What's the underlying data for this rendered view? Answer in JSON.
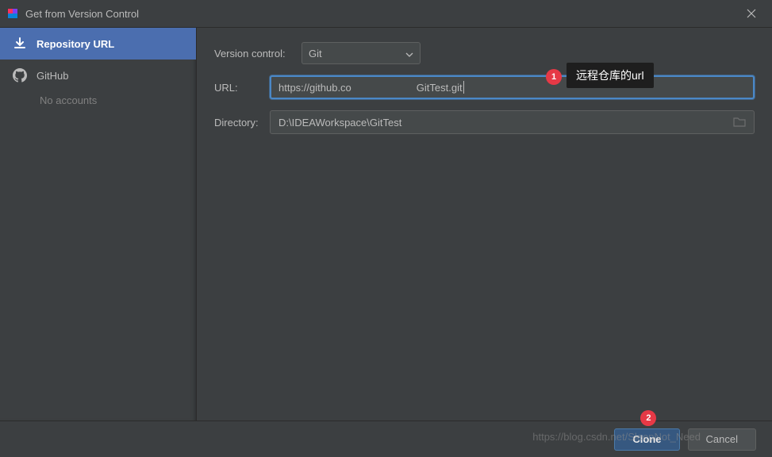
{
  "titlebar": {
    "title": "Get from Version Control"
  },
  "sidebar": {
    "items": [
      {
        "label": "Repository URL"
      },
      {
        "label": "GitHub",
        "sublabel": "No accounts"
      }
    ]
  },
  "form": {
    "version_control_label": "Version control:",
    "version_control_value": "Git",
    "url_label": "URL:",
    "url_value_prefix": "https://github.co",
    "url_value_suffix": "GitTest.git",
    "directory_label": "Directory:",
    "directory_value": "D:\\IDEAWorkspace\\GitTest"
  },
  "annotations": {
    "badge1": "1",
    "label1": "远程仓库的url",
    "badge2": "2"
  },
  "footer": {
    "clone": "Clone",
    "cancel": "Cancel"
  },
  "watermark": "https://blog.csdn.net/SleepNot_Need"
}
